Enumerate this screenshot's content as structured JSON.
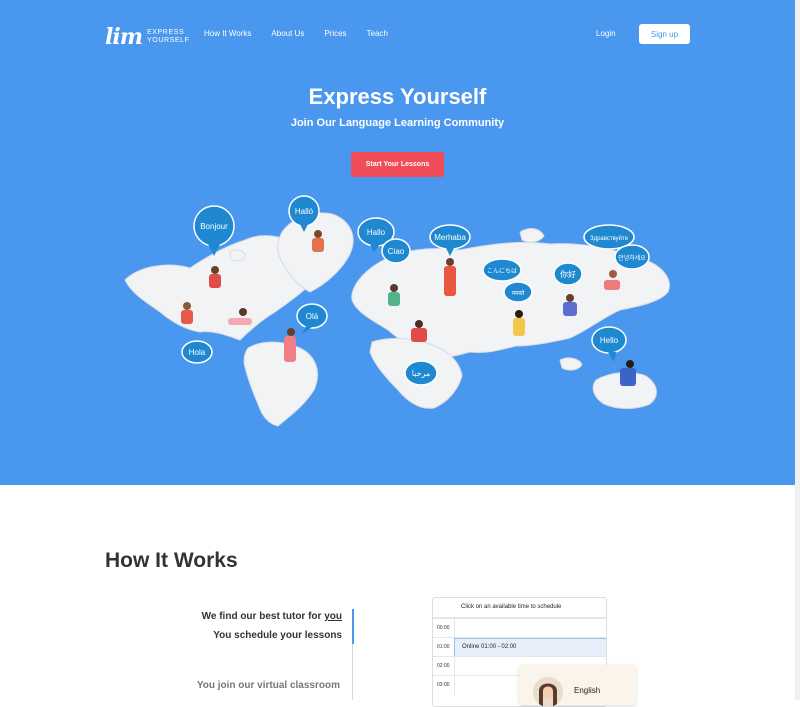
{
  "nav": {
    "logo_mark": "lim",
    "logo_line1": "EXPRESS",
    "logo_line2": "YOURSELF",
    "links": [
      "How It Works",
      "About Us",
      "Prices",
      "Teach"
    ],
    "login": "Login",
    "signup": "Sign up"
  },
  "hero": {
    "title": "Express Yourself",
    "subtitle": "Join Our Language Learning Community",
    "cta": "Start Your Lessons",
    "bubbles": [
      "Bonjour",
      "Halló",
      "Hallo",
      "Ciao",
      "Merhaba",
      "Здравствуйте",
      "안녕하세요",
      "こんにちは",
      "你好",
      "नमस्ते",
      "Olá",
      "Hola",
      "Hello",
      "مرحبا"
    ]
  },
  "how_it_works": {
    "title": "How It Works",
    "step1_prefix": "We find our best tutor for ",
    "step1_link": "you",
    "step2": "You schedule your lessons",
    "step3": "You join our virtual classroom"
  },
  "schedule": {
    "header": "Click on an available time to schedule",
    "times": [
      "00:00",
      "01:00",
      "02:00",
      "03:00"
    ],
    "booked_slot": "Online 01:00 - 02:00"
  },
  "tutor": {
    "language": "English"
  },
  "colors": {
    "hero_bg": "#4a97ef",
    "cta_bg": "#f14d58",
    "bubble": "#1e88d0"
  }
}
